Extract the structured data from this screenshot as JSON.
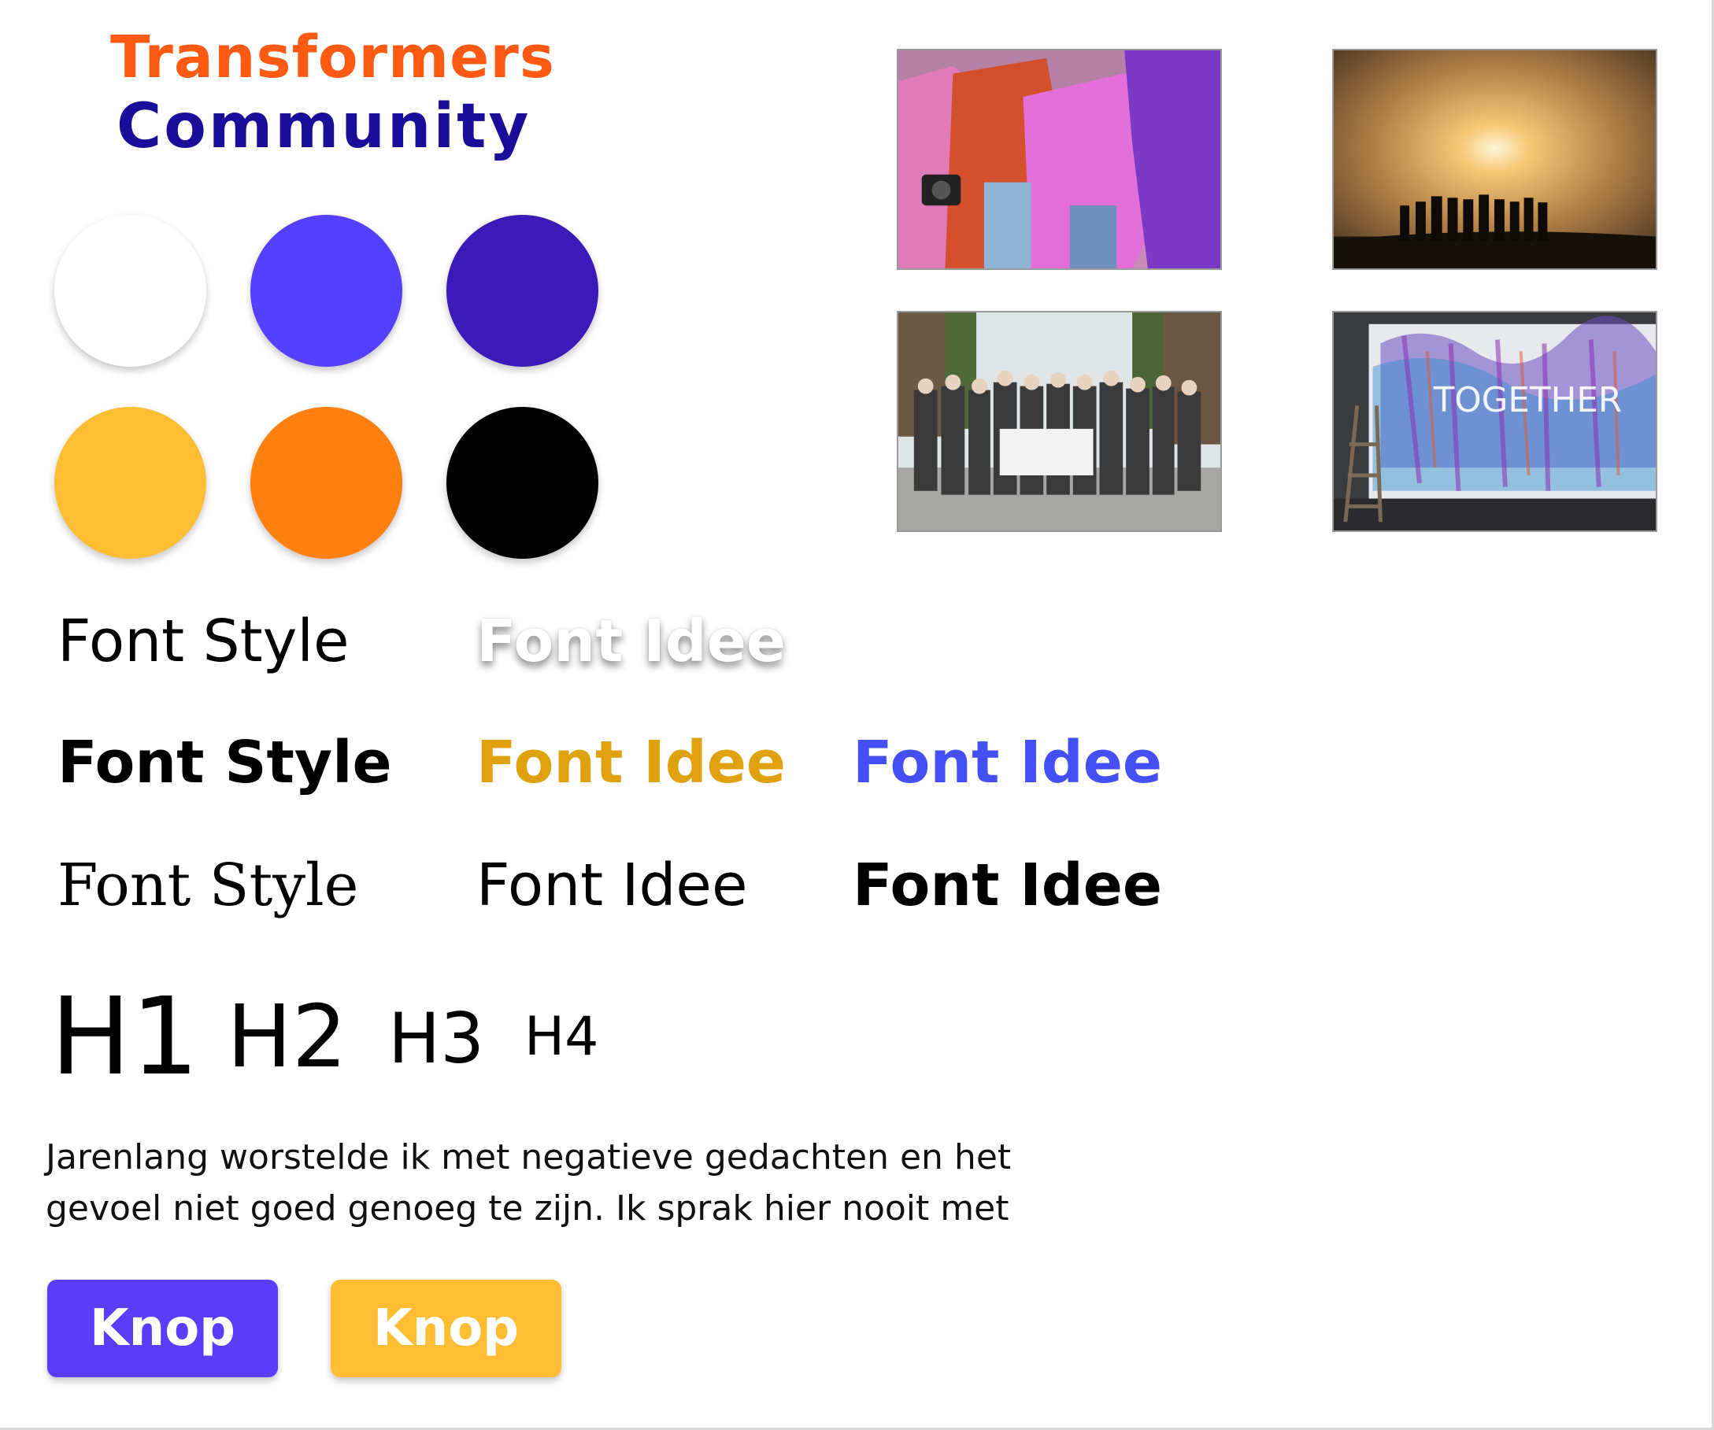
{
  "logo": {
    "line1": "Transformers",
    "line2": "Community",
    "line1_color": "#ff5a14",
    "line2_color": "#1a0d99"
  },
  "swatches": [
    {
      "name": "white",
      "color": "#ffffff"
    },
    {
      "name": "violet",
      "color": "#5440ff"
    },
    {
      "name": "indigo",
      "color": "#3a1ab8"
    },
    {
      "name": "amber",
      "color": "#ffbd33"
    },
    {
      "name": "orange",
      "color": "#ff800f"
    },
    {
      "name": "black",
      "color": "#000000"
    }
  ],
  "photos": [
    {
      "icon": "group-hug-photo"
    },
    {
      "icon": "sunset-silhouettes-photo"
    },
    {
      "icon": "group-portrait-photo"
    },
    {
      "icon": "together-mural-photo"
    }
  ],
  "mural_text": "TOGETHER",
  "font_samples": {
    "row1": {
      "style": "Font Style",
      "idee": "Font Idee"
    },
    "row2": {
      "style": "Font Style",
      "idee_gold": "Font Idee",
      "idee_blue": "Font Idee"
    },
    "row3": {
      "style": "Font Style",
      "idee_light": "Font Idee",
      "idee_bold": "Font Idee"
    },
    "colors": {
      "gold": "#e0a10e",
      "blue": "#4450f5"
    }
  },
  "headings": [
    "H1",
    "H2",
    "H3",
    "H4"
  ],
  "paragraph": {
    "line1": "Jarenlang worstelde ik met negatieve gedachten en het",
    "line2": "gevoel niet goed genoeg te zijn. Ik sprak hier nooit met"
  },
  "buttons": {
    "primary_label": "Knop",
    "secondary_label": "Knop",
    "primary_color": "#5a3cfa",
    "secondary_color": "#ffbd33"
  }
}
